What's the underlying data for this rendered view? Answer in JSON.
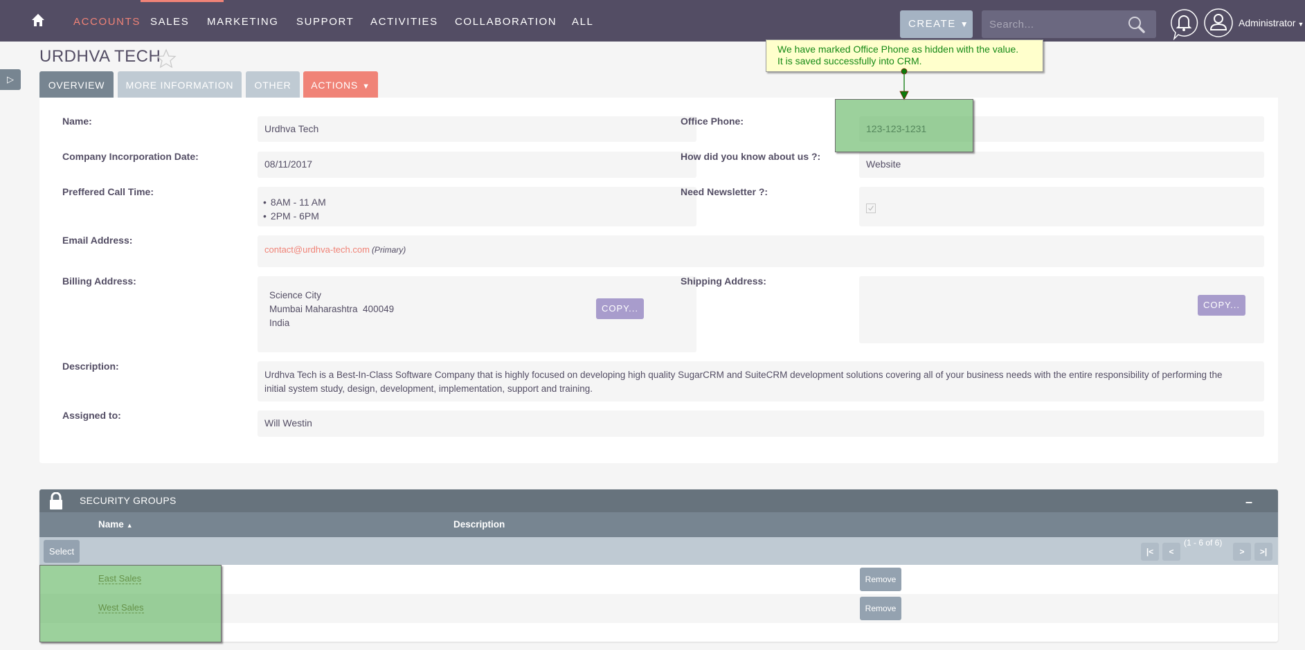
{
  "nav": {
    "home_icon": "home-icon",
    "items": [
      {
        "label": "ACCOUNTS",
        "active": true
      },
      {
        "label": "SALES"
      },
      {
        "label": "MARKETING"
      },
      {
        "label": "SUPPORT"
      },
      {
        "label": "ACTIVITIES"
      },
      {
        "label": "COLLABORATION"
      },
      {
        "label": "ALL"
      }
    ],
    "create_label": "CREATE",
    "search_placeholder": "Search...",
    "user_label": "Administrator"
  },
  "colors": {
    "nav_bg": "#534d64",
    "accent": "#f08377",
    "tab_active": "#778591",
    "tab_inactive": "#bfcad3",
    "copy_button": "#a89ccc",
    "highlight": "#54b054",
    "callout_bg": "#ffffcc",
    "callout_text": "#168a16"
  },
  "record": {
    "title": "URDHVA TECH",
    "tabs": [
      "OVERVIEW",
      "MORE INFORMATION",
      "OTHER"
    ],
    "actions_label": "ACTIONS"
  },
  "fields": {
    "name": {
      "label": "Name:",
      "value": "Urdhva Tech"
    },
    "office_phone": {
      "label": "Office Phone:",
      "value": "123-123-1231"
    },
    "incorporation_date": {
      "label": "Company Incorporation Date:",
      "value": "08/11/2017"
    },
    "how_know": {
      "label": "How did you know about us ?:",
      "value": "Website"
    },
    "call_time": {
      "label": "Preffered Call Time:",
      "values": [
        "8AM - 11 AM",
        "2PM - 6PM"
      ]
    },
    "newsletter": {
      "label": "Need Newsletter ?:",
      "checked": true
    },
    "email": {
      "label": "Email Address:",
      "value": "contact@urdhva-tech.com",
      "tag": "(Primary)"
    },
    "billing": {
      "label": "Billing Address:",
      "lines": [
        "Science City",
        "Mumbai Maharashtra  400049",
        "India"
      ],
      "copy_label": "COPY..."
    },
    "shipping": {
      "label": "Shipping Address:",
      "copy_label": "COPY..."
    },
    "description": {
      "label": "Description:",
      "value": "Urdhva Tech is a Best-In-Class Software Company that is highly focused on developing high quality SugarCRM and SuiteCRM development solutions covering all of your business needs with the entire responsibility of performing the initial system study, design, development, implementation, support and training."
    },
    "assigned": {
      "label": "Assigned to:",
      "value": "Will Westin"
    }
  },
  "security_groups": {
    "title": "SECURITY GROUPS",
    "collapse_label": "–",
    "columns": [
      "Name",
      "Description"
    ],
    "select_label": "Select",
    "pagination": {
      "first": "|<",
      "prev": "<",
      "count": "(1 - 6 of 6)",
      "next": ">",
      "last": ">|"
    },
    "rows": [
      {
        "name": "East Sales",
        "description": "",
        "action": "Remove"
      },
      {
        "name": "West Sales",
        "description": "",
        "action": "Remove"
      }
    ]
  },
  "annotation": {
    "callout_lines": [
      "We have marked Office Phone as hidden with the value.",
      "It is saved successfully into CRM."
    ]
  }
}
